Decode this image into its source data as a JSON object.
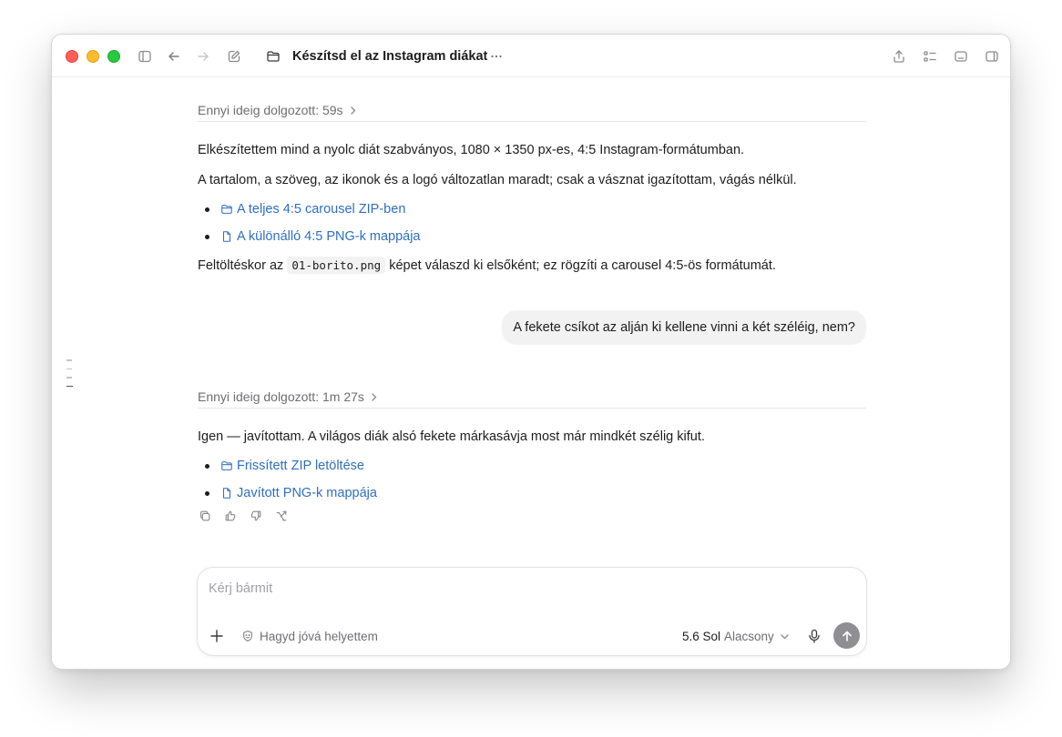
{
  "window": {
    "title": "Készítsd el az Instagram diákat"
  },
  "toolbar": {
    "icons": [
      "sidebar-toggle-icon",
      "back-arrow-icon",
      "forward-arrow-icon",
      "compose-icon",
      "folder-icon",
      "more-icon",
      "share-icon",
      "checklist-icon",
      "panel-bottom-icon",
      "panel-right-icon"
    ]
  },
  "conversation": {
    "turn1": {
      "thought_label": "Ennyi ideig dolgozott: 59s",
      "para1": "Elkészítettem mind a nyolc diát szabványos, 1080 × 1350 px-es, 4:5 Instagram-formátumban.",
      "para2": "A tartalom, a szöveg, az ikonok és a logó változatlan maradt; csak a vásznat igazítottam, vágás nélkül.",
      "links": [
        {
          "label": "A teljes 4:5 carousel ZIP-ben",
          "icon": "folder-icon"
        },
        {
          "label": "A különálló 4:5 PNG-k mappája",
          "icon": "file-icon"
        }
      ],
      "para3_before": "Feltöltéskor az",
      "para3_code": "01-borito.png",
      "para3_after": "képet válaszd ki elsőként; ez rögzíti a carousel 4:5-ös formátumát."
    },
    "user_message": "A fekete csíkot az alján ki kellene vinni a két széléig, nem?",
    "turn2": {
      "thought_label": "Ennyi ideig dolgozott: 1m 27s",
      "para1": "Igen — javítottam. A világos diák alsó fekete márkasávja most már mindkét szélig kifut.",
      "links": [
        {
          "label": "Frissített ZIP letöltése",
          "icon": "folder-icon"
        },
        {
          "label": "Javított PNG-k mappája",
          "icon": "file-icon"
        }
      ]
    }
  },
  "composer": {
    "placeholder": "Kérj bármit",
    "approve_label": "Hagyd jóvá helyettem",
    "model_name": "5.6 Sol",
    "model_effort": "Alacsony"
  },
  "colors": {
    "link": "#2f6fbf",
    "close": "#fe5f57",
    "minimize": "#febc2e",
    "maximize": "#28c840",
    "send_button": "#8e8e93"
  }
}
